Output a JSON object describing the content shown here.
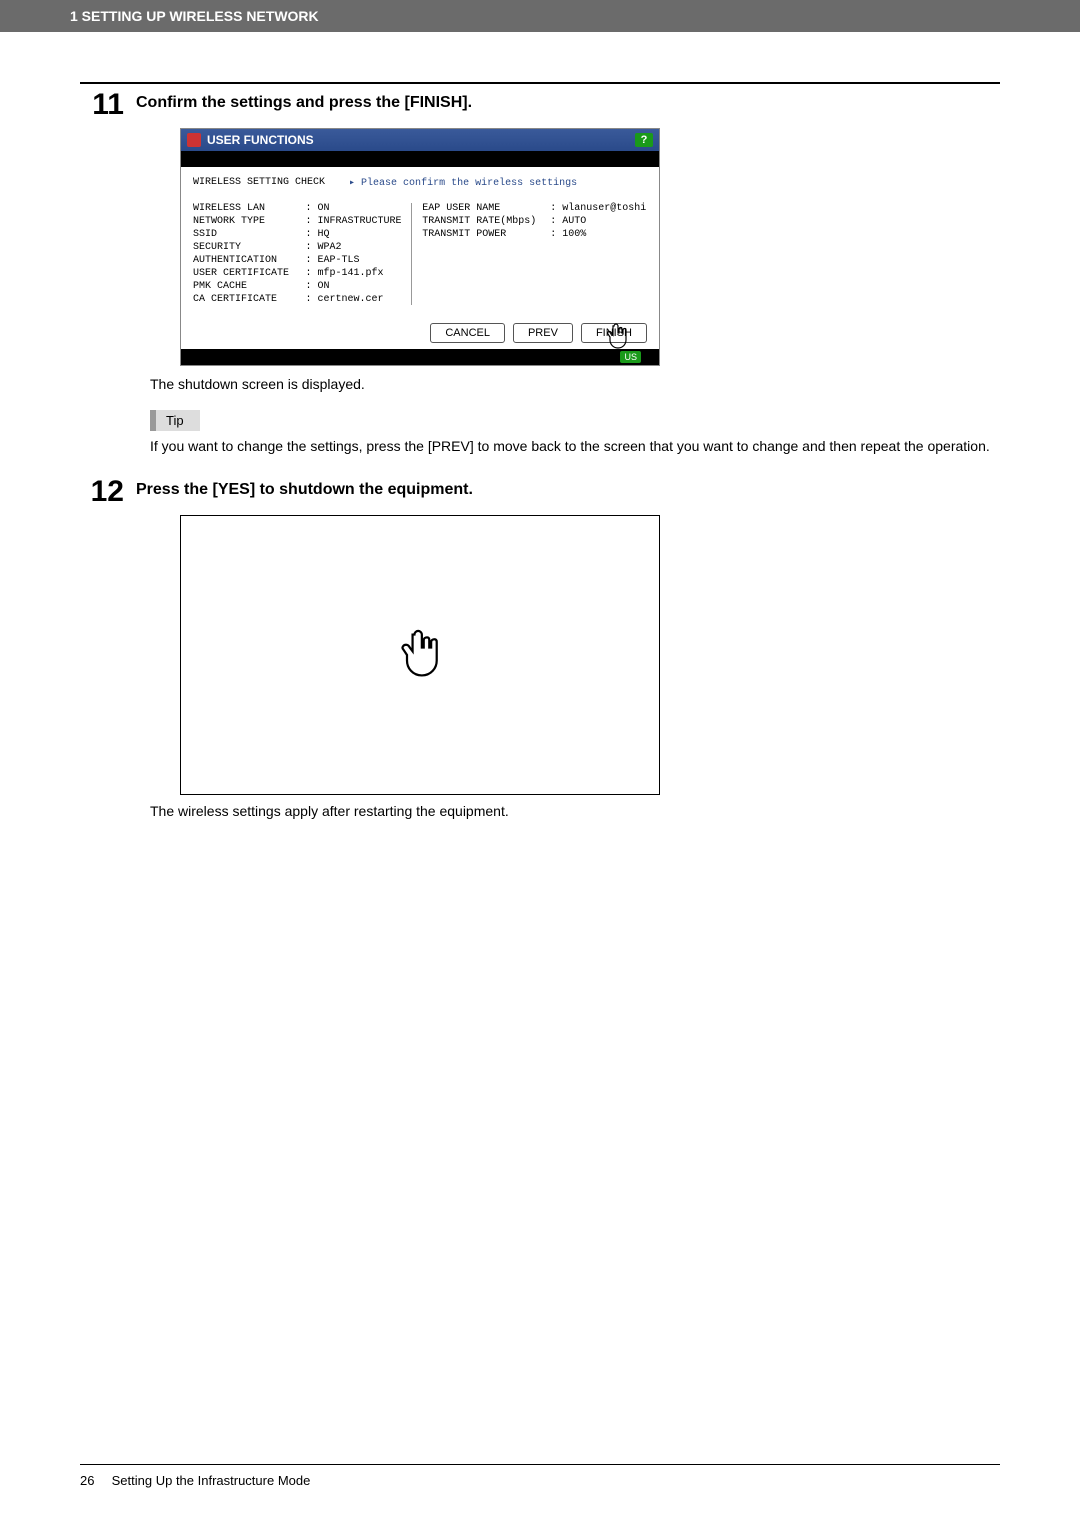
{
  "header": {
    "chapter": "1 SETTING UP WIRELESS NETWORK"
  },
  "step11": {
    "num": "11",
    "title": "Confirm the settings and press the [FINISH].",
    "caption": "The shutdown screen is displayed.",
    "tip_label": "Tip",
    "tip_text": "If you want to change the settings, press the [PREV] to move back to the screen that you want to change and then repeat the operation."
  },
  "printer_ui": {
    "title": "USER FUNCTIONS",
    "help": "?",
    "check_label": "WIRELESS SETTING CHECK",
    "check_msg": "▸ Please confirm the wireless settings",
    "left_labels": [
      "WIRELESS LAN",
      "NETWORK TYPE",
      "SSID",
      "SECURITY",
      "AUTHENTICATION",
      "USER CERTIFICATE",
      "PMK CACHE",
      "CA CERTIFICATE"
    ],
    "left_values": [
      ": ON",
      ": INFRASTRUCTURE",
      ": HQ",
      ": WPA2",
      ": EAP-TLS",
      ": mfp-141.pfx",
      ": ON",
      ": certnew.cer"
    ],
    "right_labels": [
      "EAP USER NAME",
      "TRANSMIT RATE(Mbps)",
      "TRANSMIT POWER"
    ],
    "right_values": [
      ": wlanuser@toshi",
      ": AUTO",
      ": 100%"
    ],
    "buttons": {
      "cancel": "CANCEL",
      "prev": "PREV",
      "finish": "FINISH"
    },
    "us": "US"
  },
  "step12": {
    "num": "12",
    "title": "Press the [YES] to shutdown the equipment.",
    "caption": "The wireless settings apply after restarting the equipment."
  },
  "footer": {
    "page": "26",
    "section": "Setting Up the Infrastructure Mode"
  }
}
